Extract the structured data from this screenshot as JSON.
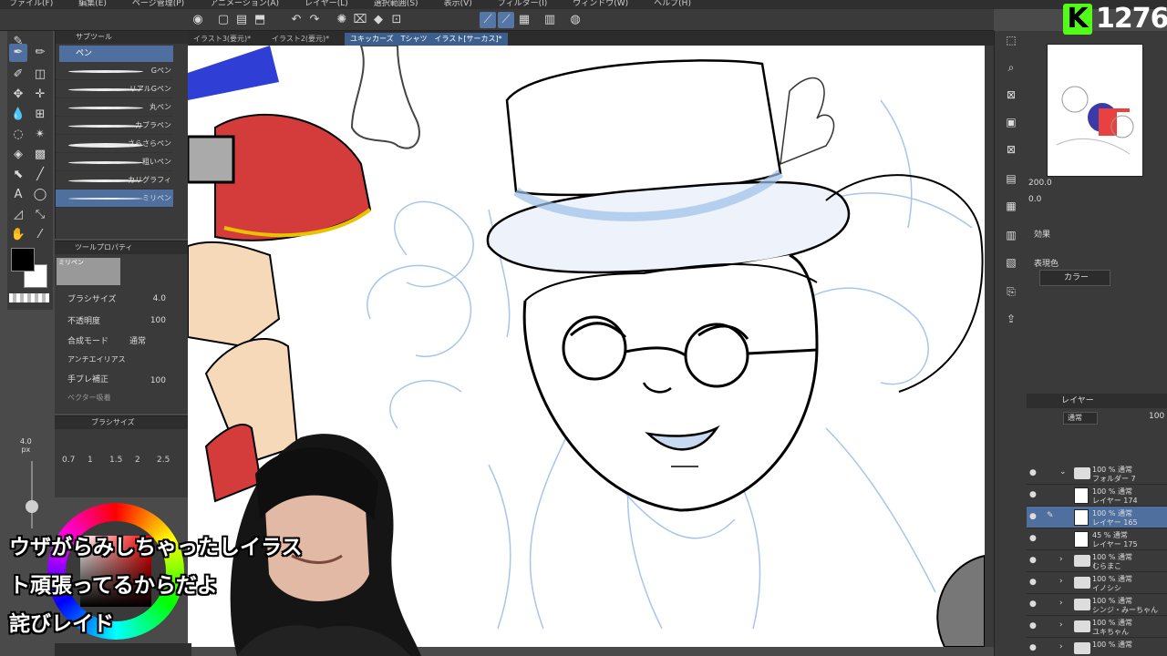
{
  "menu": [
    "ファイル(F)",
    "編集(E)",
    "ページ管理(P)",
    "アニメーション(A)",
    "レイヤー(L)",
    "選択範囲(S)",
    "表示(V)",
    "フィルター(I)",
    "ウィンドウ(W)",
    "ヘルプ(H)"
  ],
  "subtool": {
    "header": "サブツール",
    "selected": "ペン",
    "brushes": [
      "Gペン",
      "リアルGペン",
      "丸ペン",
      "カブラペン",
      "さらさらペン",
      "粗いペン",
      "カリグラフィ",
      "ミリペン"
    ]
  },
  "toolprop": {
    "header": "ツールプロパティ",
    "preview_label": "ミリペン",
    "rows": [
      {
        "label": "ブラシサイズ",
        "value": "4.0"
      },
      {
        "label": "不透明度",
        "value": "100"
      },
      {
        "label": "合成モード",
        "value": "通常"
      },
      {
        "label": "アンチエイリアス",
        "value": ""
      },
      {
        "label": "手ブレ補正",
        "value": "100"
      },
      {
        "label": "ベクター吸着",
        "value": ""
      }
    ]
  },
  "brushsize": {
    "header": "ブラシサイズ",
    "current": "4.0",
    "unit": "px",
    "options": [
      "0.7",
      "1",
      "1.5",
      "2",
      "2.5"
    ]
  },
  "tabs": [
    "イラスト3(要元)*",
    "イラスト2(要元)*",
    "ユキッカーズ　Tシャツ　イラスト[サーカス]*"
  ],
  "navigator": {
    "zoom": "200.0",
    "rotation": "0.0"
  },
  "panel": {
    "effect_label": "効果",
    "color_label": "表現色",
    "color_value": "カラー"
  },
  "layers": {
    "header": "レイヤー",
    "blend_mode": "通常",
    "opacity": "100",
    "items": [
      {
        "mode": "100 % 通常",
        "name": "フォルダー 7",
        "kind": "folder",
        "expanded": true,
        "selected": false
      },
      {
        "mode": "100 % 通常",
        "name": "レイヤー 174",
        "kind": "layer",
        "expanded": false,
        "selected": false
      },
      {
        "mode": "100 % 通常",
        "name": "レイヤー 165",
        "kind": "layer",
        "expanded": false,
        "selected": true
      },
      {
        "mode": "45 % 通常",
        "name": "レイヤー 175",
        "kind": "layer",
        "expanded": false,
        "selected": false
      },
      {
        "mode": "100 % 通常",
        "name": "むらまこ",
        "kind": "folder",
        "expanded": false,
        "selected": false
      },
      {
        "mode": "100 % 通常",
        "name": "イノシシ",
        "kind": "folder",
        "expanded": false,
        "selected": false
      },
      {
        "mode": "100 % 通常",
        "name": "シンジ・みーちゃん",
        "kind": "folder",
        "expanded": false,
        "selected": false
      },
      {
        "mode": "100 % 通常",
        "name": "ユキちゃん",
        "kind": "folder",
        "expanded": false,
        "selected": false
      },
      {
        "mode": "100 % 通常",
        "name": "",
        "kind": "folder",
        "expanded": false,
        "selected": false
      }
    ]
  },
  "overlay": {
    "badge_number": "1276",
    "subtitles": [
      "ウザがらみしちゃったしイラス",
      "ト頑張ってるからだよ",
      "詫びレイド"
    ]
  },
  "colors": {
    "accent": "#4f6f9e",
    "sketch": "#9cc0e8",
    "badge": "#53fc18"
  }
}
